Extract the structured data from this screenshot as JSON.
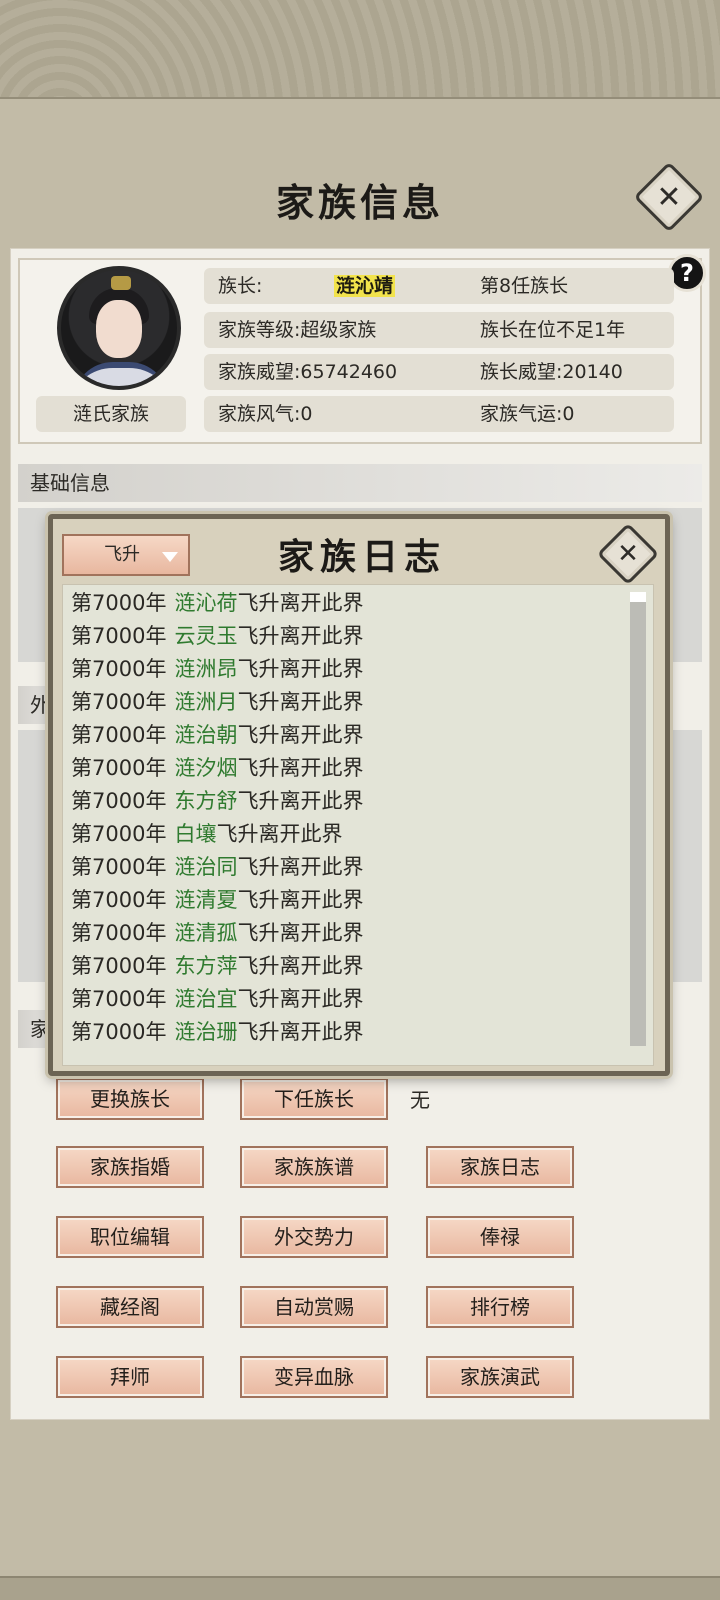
{
  "page_title": "家族信息",
  "family": {
    "name": "涟氏家族",
    "leader_label": "族长:",
    "leader_name": "涟沁靖",
    "leader_gen": "第8任族长",
    "level": "家族等级:超级家族",
    "tenure": "族长在位不足1年",
    "prestige": "家族威望:65742460",
    "leader_prestige": "族长威望:20140",
    "fengqi": "家族风气:0",
    "qiyun": "家族气运:0"
  },
  "help_label": "?",
  "close_label": "✕",
  "sections": {
    "basic": "基础信息",
    "foreign_partial": "外",
    "family_partial": "家"
  },
  "next_leader_value": "无",
  "buttons": {
    "change_leader": "更换族长",
    "next_leader": "下任族长",
    "marriage": "家族指婚",
    "genealogy": "家族族谱",
    "log": "家族日志",
    "positions": "职位编辑",
    "diplomacy": "外交势力",
    "salary": "俸禄",
    "library": "藏经阁",
    "auto_reward": "自动赏赐",
    "ranking": "排行榜",
    "apprentice": "拜师",
    "bloodline": "变异血脉",
    "martial": "家族演武"
  },
  "log_dialog": {
    "title": "家族日志",
    "filter_value": "飞升",
    "entries": [
      {
        "year": "第7000年",
        "name": "涟沁荷",
        "event": "飞升离开此界"
      },
      {
        "year": "第7000年",
        "name": "云灵玉",
        "event": "飞升离开此界"
      },
      {
        "year": "第7000年",
        "name": "涟洲昂",
        "event": "飞升离开此界"
      },
      {
        "year": "第7000年",
        "name": "涟洲月",
        "event": "飞升离开此界"
      },
      {
        "year": "第7000年",
        "name": "涟治朝",
        "event": "飞升离开此界"
      },
      {
        "year": "第7000年",
        "name": "涟汐烟",
        "event": "飞升离开此界"
      },
      {
        "year": "第7000年",
        "name": "东方舒",
        "event": "飞升离开此界"
      },
      {
        "year": "第7000年",
        "name": "白壤",
        "event": "飞升离开此界"
      },
      {
        "year": "第7000年",
        "name": "涟治同",
        "event": "飞升离开此界"
      },
      {
        "year": "第7000年",
        "name": "涟清夏",
        "event": "飞升离开此界"
      },
      {
        "year": "第7000年",
        "name": "涟清孤",
        "event": "飞升离开此界"
      },
      {
        "year": "第7000年",
        "name": "东方萍",
        "event": "飞升离开此界"
      },
      {
        "year": "第7000年",
        "name": "涟治宜",
        "event": "飞升离开此界"
      },
      {
        "year": "第7000年",
        "name": "涟治珊",
        "event": "飞升离开此界"
      }
    ]
  },
  "colors": {
    "name_green": "#2f7a2f",
    "leader_highlight": "#f2e34c",
    "button_fill": "#e8b79f"
  }
}
